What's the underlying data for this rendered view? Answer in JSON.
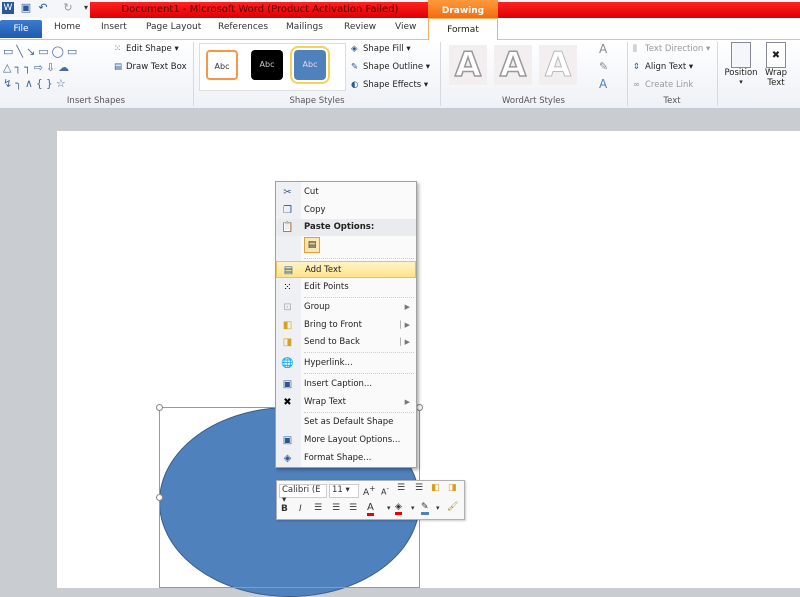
{
  "window": {
    "title": "Document1  -  Microsoft Word (Product Activation Failed)",
    "context_tab_group": "Drawing Tools"
  },
  "tabs": [
    "File",
    "Home",
    "Insert",
    "Page Layout",
    "References",
    "Mailings",
    "Review",
    "View",
    "Format"
  ],
  "ribbon": {
    "insert_shapes": {
      "label": "Insert Shapes",
      "edit_shape": "Edit Shape",
      "draw_text_box": "Draw Text Box"
    },
    "shape_styles": {
      "label": "Shape Styles",
      "samples": [
        "Abc",
        "Abc",
        "Abc"
      ],
      "shape_fill": "Shape Fill",
      "shape_outline": "Shape Outline",
      "shape_effects": "Shape Effects"
    },
    "wordart_styles": {
      "label": "WordArt Styles",
      "samples": [
        "A",
        "A",
        "A"
      ]
    },
    "text": {
      "label": "Text",
      "text_direction": "Text Direction",
      "align_text": "Align Text",
      "create_link": "Create Link"
    },
    "arrange": {
      "position": "Position",
      "wrap_text_1": "Wrap",
      "wrap_text_2": "Text"
    }
  },
  "context_menu": {
    "items": [
      "Cut",
      "Copy",
      "Paste Options:",
      "Add Text",
      "Edit Points",
      "Group",
      "Bring to Front",
      "Send to Back",
      "Hyperlink...",
      "Insert Caption...",
      "Wrap Text",
      "Set as Default Shape",
      "More Layout Options...",
      "Format Shape..."
    ]
  },
  "mini_toolbar": {
    "font": "Calibri (E",
    "size": "11"
  },
  "colors": {
    "accent": "#4f81bd",
    "title_bar": "#e00000",
    "drawing_tools": "#f07a20"
  }
}
